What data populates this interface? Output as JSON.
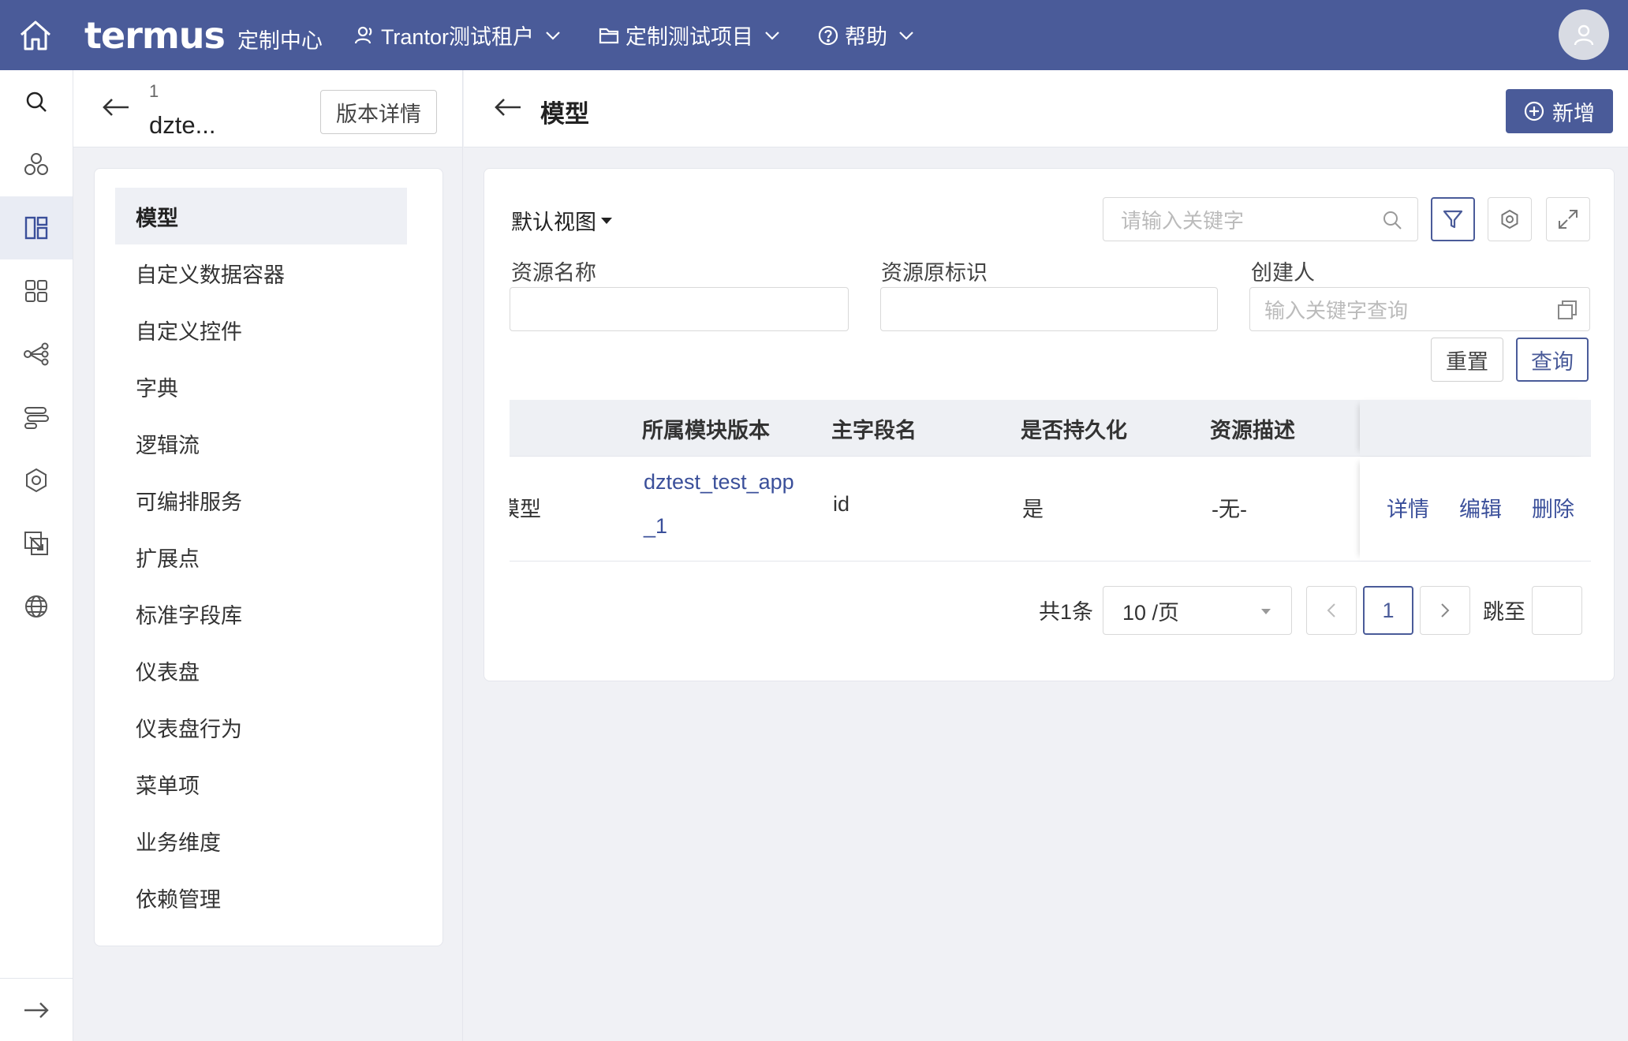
{
  "topbar": {
    "logo_word": "termus",
    "logo_sub": "定制中心",
    "tenant": "Trantor测试租户",
    "project": "定制测试项目",
    "help": "帮助",
    "bg_color": "#4a5b99"
  },
  "version_panel": {
    "number": "1",
    "name": "dzte...",
    "detail_button": "版本详情"
  },
  "side_menu": {
    "items": [
      {
        "label": "模型"
      },
      {
        "label": "自定义数据容器"
      },
      {
        "label": "自定义控件"
      },
      {
        "label": "字典"
      },
      {
        "label": "逻辑流"
      },
      {
        "label": "可编排服务"
      },
      {
        "label": "扩展点"
      },
      {
        "label": "标准字段库"
      },
      {
        "label": "仪表盘"
      },
      {
        "label": "仪表盘行为"
      },
      {
        "label": "菜单项"
      },
      {
        "label": "业务维度"
      },
      {
        "label": "依赖管理"
      }
    ]
  },
  "main": {
    "title": "模型",
    "add_button": "新增",
    "view_selector": "默认视图",
    "search_placeholder": "请输入关键字",
    "filters": {
      "resource_name_label": "资源名称",
      "resource_id_label": "资源原标识",
      "creator_label": "创建人",
      "creator_placeholder": "输入关键字查询"
    },
    "reset_button": "重置",
    "query_button": "查询",
    "table": {
      "columns": [
        "所属模块版本",
        "主字段名",
        "是否持久化",
        "资源描述"
      ],
      "rows": [
        {
          "name_fragment": "模型",
          "module_version_line1": "dztest_test_app",
          "module_version_line2": "_1",
          "main_field": "id",
          "persistent": "是",
          "description": "-无-",
          "actions": [
            "详情",
            "编辑",
            "删除"
          ]
        }
      ]
    },
    "pagination": {
      "total": "共1条",
      "page_size": "10 /页",
      "current_page": "1",
      "jump_label": "跳至"
    }
  }
}
